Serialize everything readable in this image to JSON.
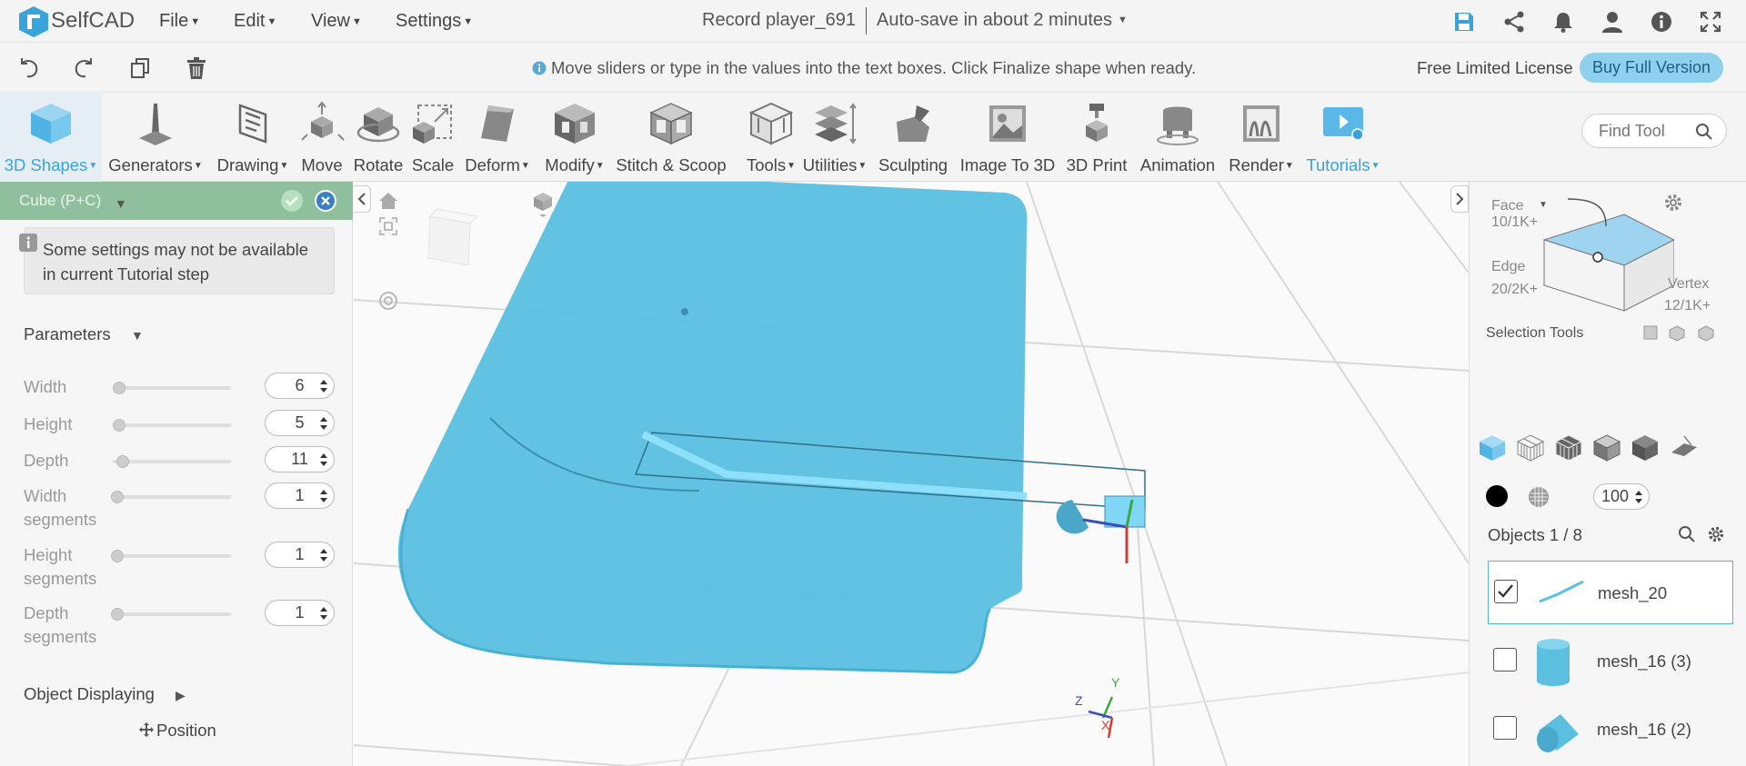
{
  "app": {
    "name": "SelfCAD"
  },
  "menubar": {
    "items": [
      {
        "label": "File"
      },
      {
        "label": "Edit"
      },
      {
        "label": "View"
      },
      {
        "label": "Settings"
      }
    ],
    "project_title": "Record player_691",
    "autosave": "Auto-save in about 2 minutes",
    "icons": [
      "save-icon",
      "share-icon",
      "bell-icon",
      "user-icon",
      "info-icon",
      "fullscreen-icon"
    ]
  },
  "secondbar": {
    "hint": "Move sliders or type in the values into the text boxes. Click Finalize shape when ready.",
    "license": "Free Limited License",
    "buy_button": "Buy Full Version",
    "icons": [
      "undo-icon",
      "redo-icon",
      "copy-icon",
      "trash-icon"
    ]
  },
  "toolbar": {
    "tools": [
      {
        "label": "3D Shapes",
        "dropdown": true,
        "active": true
      },
      {
        "label": "Generators",
        "dropdown": true
      },
      {
        "label": "Drawing",
        "dropdown": true
      },
      {
        "label": "Move"
      },
      {
        "label": "Rotate"
      },
      {
        "label": "Scale"
      },
      {
        "label": "Deform",
        "dropdown": true
      },
      {
        "label": "Modify",
        "dropdown": true
      },
      {
        "label": "Stitch & Scoop"
      },
      {
        "label": "Tools",
        "dropdown": true
      },
      {
        "label": "Utilities",
        "dropdown": true
      },
      {
        "label": "Sculpting"
      },
      {
        "label": "Image To 3D"
      },
      {
        "label": "3D Print"
      },
      {
        "label": "Animation"
      },
      {
        "label": "Render",
        "dropdown": true
      },
      {
        "label": "Tutorials",
        "dropdown": true
      }
    ],
    "find_tool_placeholder": "Find Tool"
  },
  "leftpanel": {
    "header": "Cube (P+C)",
    "notice": "Some settings may not be available in current Tutorial step",
    "parameters_title": "Parameters",
    "params": [
      {
        "label": "Width",
        "value": "6"
      },
      {
        "label": "Height",
        "value": "5"
      },
      {
        "label": "Depth",
        "value": "11"
      },
      {
        "label": "Width segments",
        "value": "1"
      },
      {
        "label": "Height segments",
        "value": "1"
      },
      {
        "label": "Depth segments",
        "value": "1"
      }
    ],
    "object_displaying": "Object Displaying",
    "position": "Position"
  },
  "rightpanel": {
    "face": "Face",
    "face_count": "10/1K+",
    "edge": "Edge",
    "edge_count": "20/2K+",
    "vertex": "Vertex",
    "vertex_count": "12/1K+",
    "selection_tools": "Selection Tools",
    "opacity": "100",
    "objects_count": "Objects 1 / 8",
    "objects": [
      {
        "name": "mesh_20",
        "checked": true
      },
      {
        "name": "mesh_16 (3)",
        "checked": false
      },
      {
        "name": "mesh_16 (2)",
        "checked": false
      }
    ]
  },
  "viewport": {
    "axis_labels": {
      "x": "X",
      "y": "Y",
      "z": "Z"
    },
    "model_color": "#5bc0e0"
  },
  "colors": {
    "accent": "#3aa3d9",
    "panel_header": "#8fbf9c",
    "buy_button": "#8fd0ef"
  }
}
